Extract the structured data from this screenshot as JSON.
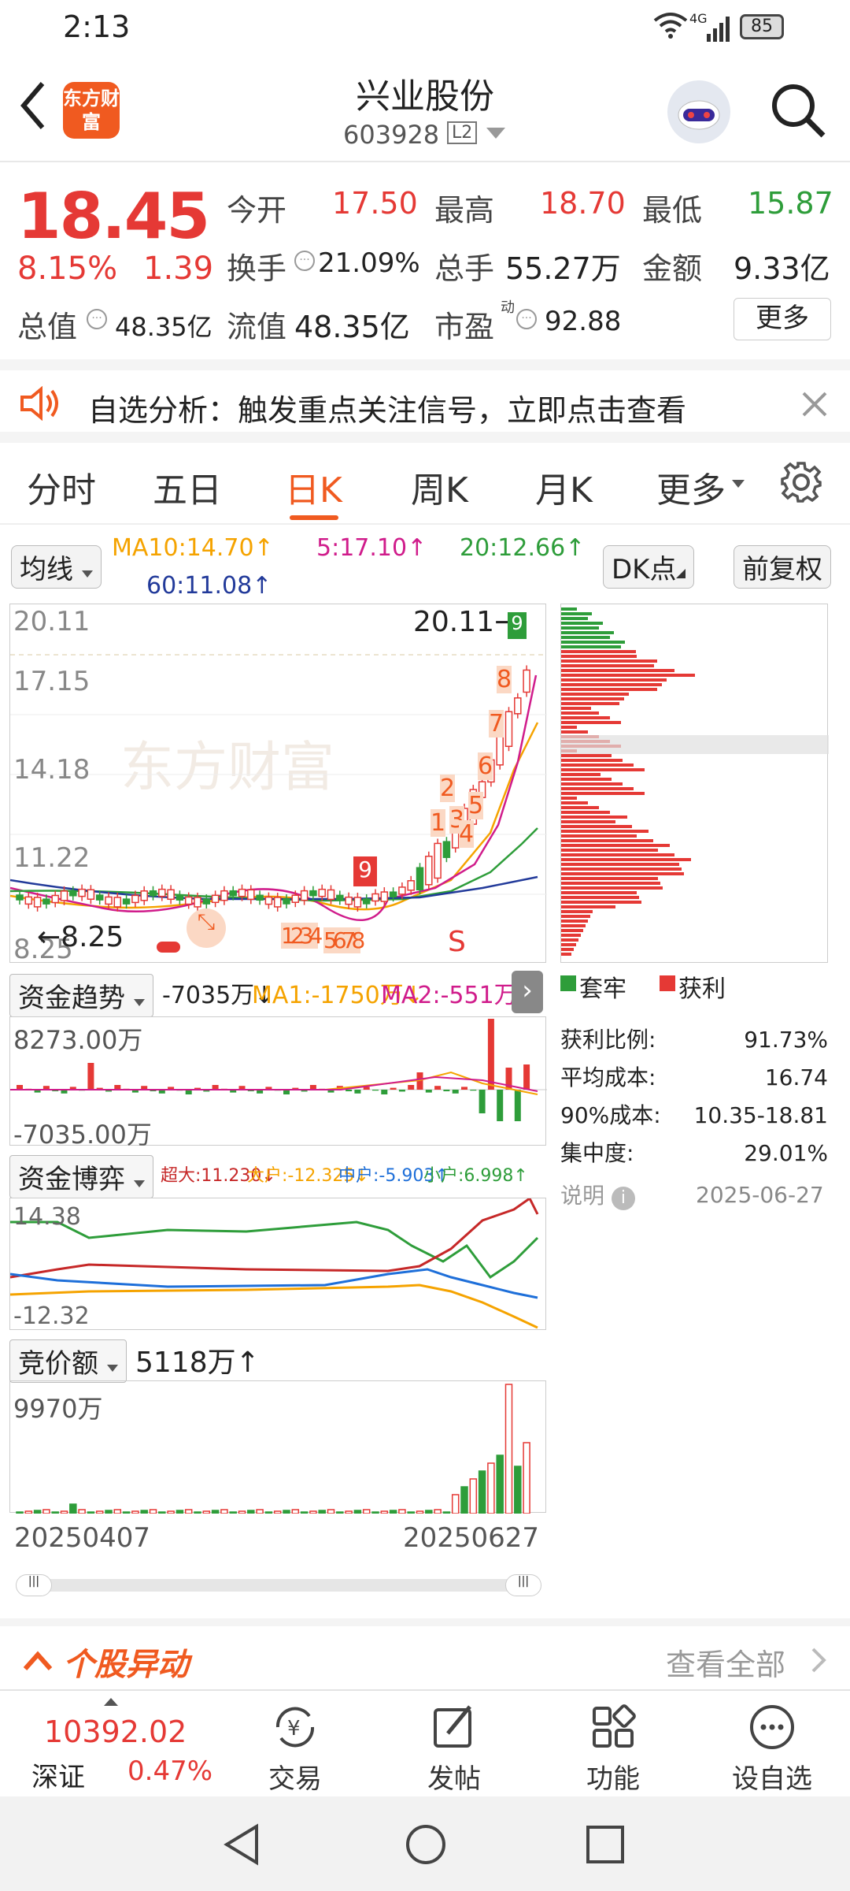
{
  "status": {
    "time": "2:13",
    "net": "4G",
    "battery": "85"
  },
  "header": {
    "logo": "东方财富",
    "title": "兴业股份",
    "code": "603928",
    "badge": "L2"
  },
  "quote": {
    "price": "18.45",
    "pct": "8.15%",
    "change": "1.39",
    "open_label": "今开",
    "open": "17.50",
    "high_label": "最高",
    "high": "18.70",
    "low_label": "最低",
    "low": "15.87",
    "turnover_label": "换手",
    "turnover": "21.09%",
    "volume_label": "总手",
    "volume": "55.27万",
    "amount_label": "金额",
    "amount": "9.33亿",
    "mktcap_label": "总值",
    "mktcap": "48.35亿",
    "float_label": "流值",
    "float": "48.35亿",
    "pe_label": "市盈",
    "pe_sup": "动",
    "pe": "92.88",
    "more": "更多"
  },
  "notice": {
    "text": "自选分析：触发重点关注信号，立即点击查看"
  },
  "tabs": [
    "分时",
    "五日",
    "日K",
    "周K",
    "月K",
    "更多"
  ],
  "kline": {
    "ma_select": "均线",
    "ma10": "MA10:14.70↑",
    "ma5": "5:17.10↑",
    "ma20": "20:12.66↑",
    "ma60": "60:11.08↑",
    "dk": "DK点",
    "fq": "前复权",
    "yticks": [
      "20.11",
      "17.15",
      "14.18",
      "11.22",
      "8.25"
    ],
    "max_label": "20.11",
    "min_label": "8.25",
    "watermark": "东方财富",
    "signals": [
      "1",
      "2",
      "3",
      "4",
      "5",
      "6",
      "7",
      "8",
      "9",
      "9",
      "1234",
      "5678",
      "S"
    ]
  },
  "fund": {
    "select": "资金趋势",
    "v": "-7035万↓",
    "ma1": "MA1:-1750万↓",
    "ma2": "MA2:-551万↓",
    "top": "8273.00万",
    "bottom": "-7035.00万"
  },
  "game": {
    "select": "资金博弈",
    "super": "超大:11.230↓",
    "large": "大户:-12.325↓",
    "mid": "中户:-5.903↑",
    "small": "小户:6.998↑",
    "top": "14.38",
    "bottom": "-12.32"
  },
  "auction": {
    "select": "竞价额",
    "value": "5118万↑",
    "top": "9970万"
  },
  "dates": {
    "start": "20250407",
    "end": "20250627"
  },
  "chip": {
    "legend_trap": "套牢",
    "legend_profit": "获利",
    "rows": [
      {
        "k": "获利比例:",
        "v": "91.73%"
      },
      {
        "k": "平均成本:",
        "v": "16.74"
      },
      {
        "k": "90%成本:",
        "v": "10.35-18.81"
      },
      {
        "k": "集中度:",
        "v": "29.01%"
      }
    ],
    "note": "说明",
    "date": "2025-06-27"
  },
  "anomaly": {
    "title": "个股异动",
    "view_all": "查看全部"
  },
  "bottom": {
    "index_value": "10392.02",
    "index_name": "深证",
    "index_pct": "0.47%",
    "trade": "交易",
    "post": "发帖",
    "func": "功能",
    "watch": "设自选"
  },
  "colors": {
    "up": "#e53935",
    "down": "#2e9d3a",
    "ma10": "#f5a300",
    "ma5": "#d01c8b",
    "ma20": "#2e9d3a",
    "ma60": "#223a9a"
  }
}
